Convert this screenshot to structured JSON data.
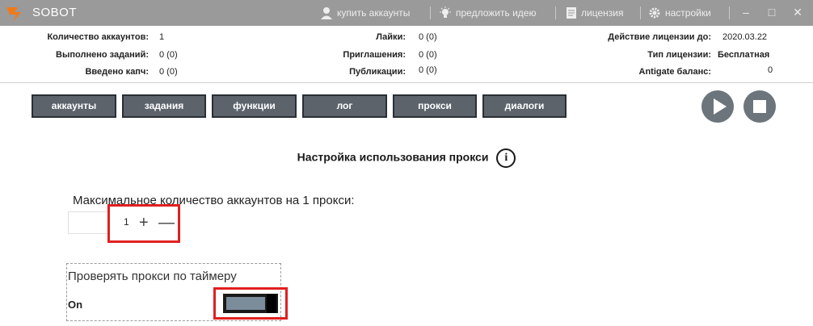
{
  "titlebar": {
    "app_title": "SOBOT",
    "buy_accounts": "купить аккаунты",
    "suggest_idea": "предложить идею",
    "license": "лицензия",
    "settings": "настройки",
    "minimize": "–",
    "maximize": "□",
    "close": "✕"
  },
  "stats": {
    "accounts_label": "Количество аккаунтов:",
    "accounts_value": "1",
    "tasks_label": "Выполнено заданий:",
    "tasks_value": "0 (0)",
    "captcha_label": "Введено капч:",
    "captcha_value": "0 (0)",
    "likes_label": "Лайки:",
    "likes_value": "0 (0)",
    "invites_label": "Приглашения:",
    "invites_value": "0 (0)",
    "posts_label": "Публикации:",
    "posts_value": "0 (0)",
    "license_until_label": "Действие лицензии до:",
    "license_until_value": "2020.03.22",
    "license_type_label": "Тип лицензии:",
    "license_type_value": "Бесплатная",
    "antigate_label": "Antigate баланс:",
    "antigate_value": "0"
  },
  "tabs": [
    "аккаунты",
    "задания",
    "функции",
    "лог",
    "прокси",
    "диалоги"
  ],
  "section": {
    "title": "Настройка использования прокси",
    "info_symbol": "i"
  },
  "max_accounts": {
    "label": "Максимальное количество аккаунтов на 1 прокси:",
    "value": "1",
    "plus": "+",
    "minus": "—"
  },
  "timer": {
    "label": "Проверять прокси по таймеру",
    "state_label": "On",
    "enabled": true
  },
  "colors": {
    "titlebar": "#9a9a9a",
    "tab_bg": "#5c636b",
    "highlight": "#e02020",
    "logo_orange": "#f07a1a"
  },
  "icons": {
    "logo": "sobot-logo-icon",
    "buy_accounts": "user-icon",
    "suggest_idea": "lightbulb-icon",
    "license": "document-icon",
    "settings": "gear-icon",
    "play": "play-icon",
    "stop": "stop-icon",
    "info": "info-icon"
  }
}
